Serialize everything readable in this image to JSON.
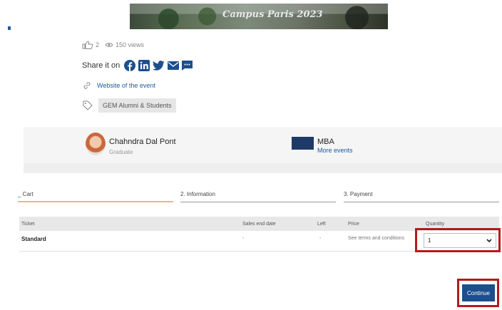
{
  "event": {
    "banner_title": "Campus Paris 2023"
  },
  "stats": {
    "likes": "2",
    "views": "150 views"
  },
  "share": {
    "label": "Share it on"
  },
  "links": {
    "website": "Website of the event"
  },
  "tags": {
    "audience": "GEM Alumni & Students"
  },
  "organizer": {
    "name": "Chahndra Dal Pont",
    "role": "Graduate"
  },
  "program": {
    "name": "MBA",
    "more": "More events"
  },
  "steps": [
    {
      "label": "_ Cart"
    },
    {
      "label": "2. Information"
    },
    {
      "label": "3. Payment"
    }
  ],
  "table": {
    "headers": {
      "ticket": "Ticket",
      "sales_end": "Sales end date",
      "left": "Left",
      "price": "Price",
      "quantity": "Quantity"
    },
    "rows": [
      {
        "ticket": "Standard",
        "sales_end": "-",
        "left": "-",
        "price": "See terms and conditions",
        "quantity": "1"
      }
    ]
  },
  "actions": {
    "continue": "Continue"
  },
  "colors": {
    "accent": "#1c4f8c",
    "link": "#1c5aa0",
    "highlight": "#b31b1b",
    "active_step": "#f0b48a"
  }
}
